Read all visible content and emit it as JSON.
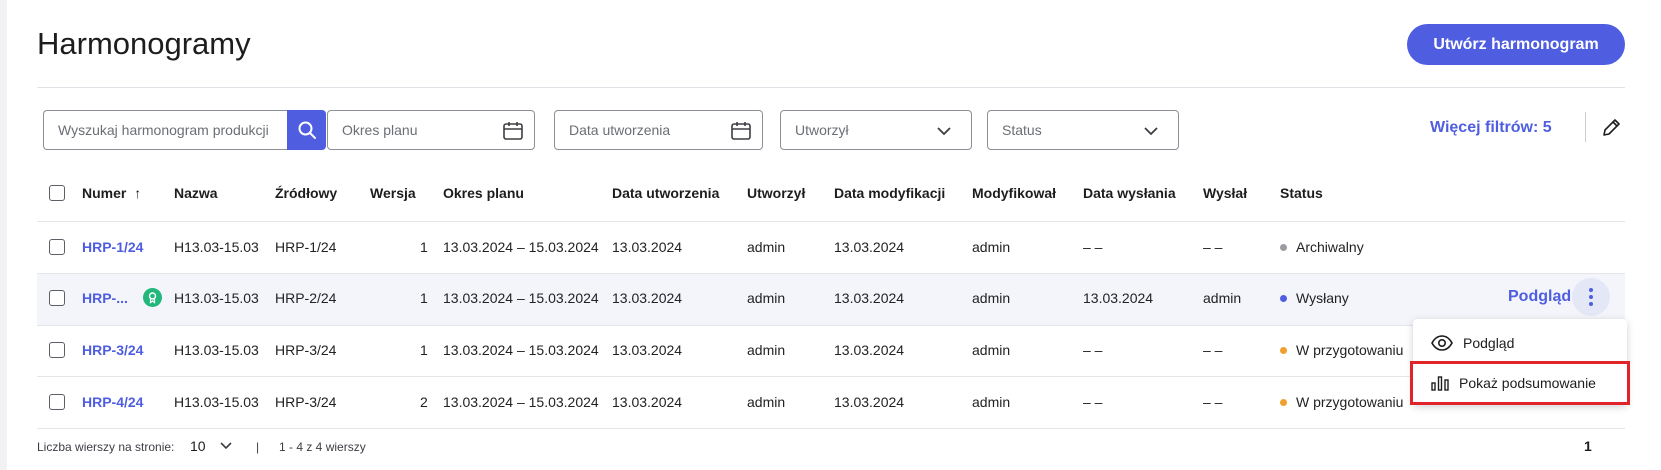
{
  "page": {
    "title": "Harmonogramy",
    "create_button": "Utwórz harmonogram"
  },
  "filters": {
    "search_placeholder": "Wyszukaj harmonogram produkcji",
    "plan_period": "Okres planu",
    "created_date": "Data utworzenia",
    "created_by": "Utworzył",
    "status": "Status",
    "more_filters": "Więcej filtrów: 5"
  },
  "table": {
    "columns": [
      "Numer",
      "Nazwa",
      "Źródłowy",
      "Wersja",
      "Okres planu",
      "Data utworzenia",
      "Utworzył",
      "Data modyfikacji",
      "Modyfikował",
      "Data wysłania",
      "Wysłał",
      "Status"
    ],
    "sort_arrow": "↑",
    "rows": [
      {
        "numer": "HRP-1/24",
        "nazwa": "H13.03-15.03",
        "zrodlowy": "HRP-1/24",
        "wersja": "1",
        "okres": "13.03.2024 – 15.03.2024",
        "data_utworzenia": "13.03.2024",
        "utworzyl": "admin",
        "data_modyfikacji": "13.03.2024",
        "modyfikowal": "admin",
        "data_wyslania": "– –",
        "wyslal": "– –",
        "status": "Archiwalny",
        "status_color": "#9a9ca1"
      },
      {
        "numer": "HRP-...",
        "nazwa": "H13.03-15.03",
        "zrodlowy": "HRP-2/24",
        "wersja": "1",
        "okres": "13.03.2024 – 15.03.2024",
        "data_utworzenia": "13.03.2024",
        "utworzyl": "admin",
        "data_modyfikacji": "13.03.2024",
        "modyfikowal": "admin",
        "data_wyslania": "13.03.2024",
        "wyslal": "admin",
        "status": "Wysłany",
        "status_color": "#4f5ee0"
      },
      {
        "numer": "HRP-3/24",
        "nazwa": "H13.03-15.03",
        "zrodlowy": "HRP-3/24",
        "wersja": "1",
        "okres": "13.03.2024 – 15.03.2024",
        "data_utworzenia": "13.03.2024",
        "utworzyl": "admin",
        "data_modyfikacji": "13.03.2024",
        "modyfikowal": "admin",
        "data_wyslania": "– –",
        "wyslal": "– –",
        "status": "W przygotowaniu",
        "status_color": "#f0a02f"
      },
      {
        "numer": "HRP-4/24",
        "nazwa": "H13.03-15.03",
        "zrodlowy": "HRP-3/24",
        "wersja": "2",
        "okres": "13.03.2024 – 15.03.2024",
        "data_utworzenia": "13.03.2024",
        "utworzyl": "admin",
        "data_modyfikacji": "13.03.2024",
        "modyfikowal": "admin",
        "data_wyslania": "– –",
        "wyslal": "– –",
        "status": "W przygotowaniu",
        "status_color": "#f0a02f"
      }
    ],
    "row_action": "Podgląd"
  },
  "context_menu": {
    "preview": "Podgląd",
    "show_summary": "Pokaż podsumowanie"
  },
  "footer": {
    "rows_per_page_label": "Liczba wierszy na stronie:",
    "rows_per_page": "10",
    "separator": "|",
    "range": "1 - 4 z 4 wierszy",
    "page": "1"
  },
  "colors": {
    "accent": "#4f5ee0",
    "highlight": "#e0242a",
    "badge": "#23b77c"
  }
}
